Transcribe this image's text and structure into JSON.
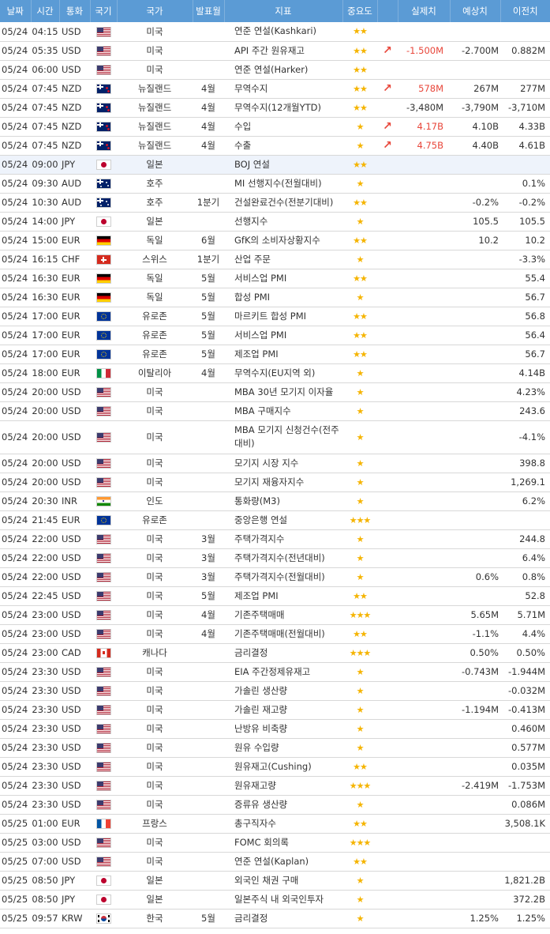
{
  "headers": {
    "date": "날짜",
    "time": "시간",
    "currency": "통화",
    "flag": "국기",
    "country": "국가",
    "period": "발표월",
    "indicator": "지표",
    "importance": "중요도",
    "arrow": "",
    "actual": "실제치",
    "forecast": "예상치",
    "previous": "이전치"
  },
  "colors": {
    "header_bg": "#5b9bd5",
    "header_text": "#ffffff",
    "star": "#f5b400",
    "actual_beat": "#e8463a",
    "row_highlight": "#eef3fb"
  },
  "rows": [
    {
      "date": "05/24",
      "time": "04:15",
      "currency": "USD",
      "flag": "us-flag",
      "country": "미국",
      "period": "",
      "indicator": "연준 연설(Kashkari)",
      "stars": "★★",
      "arrow": "",
      "actual": "",
      "forecast": "",
      "previous": ""
    },
    {
      "date": "05/24",
      "time": "05:35",
      "currency": "USD",
      "flag": "us-flag",
      "country": "미국",
      "period": "",
      "indicator": "API 주간 원유재고",
      "stars": "★★",
      "arrow": "↗",
      "actual": "-1.500M",
      "forecast": "-2.700M",
      "previous": "0.882M"
    },
    {
      "date": "05/24",
      "time": "06:00",
      "currency": "USD",
      "flag": "us-flag",
      "country": "미국",
      "period": "",
      "indicator": "연준 연설(Harker)",
      "stars": "★★",
      "arrow": "",
      "actual": "",
      "forecast": "",
      "previous": ""
    },
    {
      "date": "05/24",
      "time": "07:45",
      "currency": "NZD",
      "flag": "nz-flag",
      "country": "뉴질랜드",
      "period": "4월",
      "indicator": "무역수지",
      "stars": "★★",
      "arrow": "↗",
      "actual": "578M",
      "forecast": "267M",
      "previous": "277M"
    },
    {
      "date": "05/24",
      "time": "07:45",
      "currency": "NZD",
      "flag": "nz-flag",
      "country": "뉴질랜드",
      "period": "4월",
      "indicator": "무역수지(12개월YTD)",
      "stars": "★★",
      "arrow": "",
      "actual": "-3,480M",
      "forecast": "-3,790M",
      "previous": "-3,710M"
    },
    {
      "date": "05/24",
      "time": "07:45",
      "currency": "NZD",
      "flag": "nz-flag",
      "country": "뉴질랜드",
      "period": "4월",
      "indicator": "수입",
      "stars": "★",
      "arrow": "↗",
      "actual": "4.17B",
      "forecast": "4.10B",
      "previous": "4.33B"
    },
    {
      "date": "05/24",
      "time": "07:45",
      "currency": "NZD",
      "flag": "nz-flag",
      "country": "뉴질랜드",
      "period": "4월",
      "indicator": "수출",
      "stars": "★",
      "arrow": "↗",
      "actual": "4.75B",
      "forecast": "4.40B",
      "previous": "4.61B"
    },
    {
      "date": "05/24",
      "time": "09:00",
      "currency": "JPY",
      "flag": "jp-flag",
      "country": "일본",
      "period": "",
      "indicator": "BOJ 연설",
      "stars": "★★",
      "arrow": "",
      "actual": "",
      "forecast": "",
      "previous": ""
    },
    {
      "date": "05/24",
      "time": "09:30",
      "currency": "AUD",
      "flag": "au-flag",
      "country": "호주",
      "period": "",
      "indicator": "MI 선행지수(전월대비)",
      "stars": "★",
      "arrow": "",
      "actual": "",
      "forecast": "",
      "previous": "0.1%"
    },
    {
      "date": "05/24",
      "time": "10:30",
      "currency": "AUD",
      "flag": "au-flag",
      "country": "호주",
      "period": "1분기",
      "indicator": "건설완료건수(전분기대비)",
      "stars": "★★",
      "arrow": "",
      "actual": "",
      "forecast": "-0.2%",
      "previous": "-0.2%"
    },
    {
      "date": "05/24",
      "time": "14:00",
      "currency": "JPY",
      "flag": "jp-flag",
      "country": "일본",
      "period": "",
      "indicator": "선행지수",
      "stars": "★",
      "arrow": "",
      "actual": "",
      "forecast": "105.5",
      "previous": "105.5"
    },
    {
      "date": "05/24",
      "time": "15:00",
      "currency": "EUR",
      "flag": "de-flag",
      "country": "독일",
      "period": "6월",
      "indicator": "GfK의 소비자상황지수",
      "stars": "★★",
      "arrow": "",
      "actual": "",
      "forecast": "10.2",
      "previous": "10.2"
    },
    {
      "date": "05/24",
      "time": "16:15",
      "currency": "CHF",
      "flag": "ch-flag",
      "country": "스위스",
      "period": "1분기",
      "indicator": "산업 주문",
      "stars": "★",
      "arrow": "",
      "actual": "",
      "forecast": "",
      "previous": "-3.3%"
    },
    {
      "date": "05/24",
      "time": "16:30",
      "currency": "EUR",
      "flag": "de-flag",
      "country": "독일",
      "period": "5월",
      "indicator": "서비스업 PMI",
      "stars": "★★",
      "arrow": "",
      "actual": "",
      "forecast": "",
      "previous": "55.4"
    },
    {
      "date": "05/24",
      "time": "16:30",
      "currency": "EUR",
      "flag": "de-flag",
      "country": "독일",
      "period": "5월",
      "indicator": "합성 PMI",
      "stars": "★",
      "arrow": "",
      "actual": "",
      "forecast": "",
      "previous": "56.7"
    },
    {
      "date": "05/24",
      "time": "17:00",
      "currency": "EUR",
      "flag": "eu-flag",
      "country": "유로존",
      "period": "5월",
      "indicator": "마르키트 합성 PMI",
      "stars": "★★",
      "arrow": "",
      "actual": "",
      "forecast": "",
      "previous": "56.8"
    },
    {
      "date": "05/24",
      "time": "17:00",
      "currency": "EUR",
      "flag": "eu-flag",
      "country": "유로존",
      "period": "5월",
      "indicator": "서비스업 PMI",
      "stars": "★★",
      "arrow": "",
      "actual": "",
      "forecast": "",
      "previous": "56.4"
    },
    {
      "date": "05/24",
      "time": "17:00",
      "currency": "EUR",
      "flag": "eu-flag",
      "country": "유로존",
      "period": "5월",
      "indicator": "제조업 PMI",
      "stars": "★★",
      "arrow": "",
      "actual": "",
      "forecast": "",
      "previous": "56.7"
    },
    {
      "date": "05/24",
      "time": "18:00",
      "currency": "EUR",
      "flag": "it-flag",
      "country": "이탈리아",
      "period": "4월",
      "indicator": "무역수지(EU지역 외)",
      "stars": "★",
      "arrow": "",
      "actual": "",
      "forecast": "",
      "previous": "4.14B"
    },
    {
      "date": "05/24",
      "time": "20:00",
      "currency": "USD",
      "flag": "us-flag",
      "country": "미국",
      "period": "",
      "indicator": "MBA 30년 모기지 이자율",
      "stars": "★",
      "arrow": "",
      "actual": "",
      "forecast": "",
      "previous": "4.23%"
    },
    {
      "date": "05/24",
      "time": "20:00",
      "currency": "USD",
      "flag": "us-flag",
      "country": "미국",
      "period": "",
      "indicator": "MBA 구매지수",
      "stars": "★",
      "arrow": "",
      "actual": "",
      "forecast": "",
      "previous": "243.6"
    },
    {
      "date": "05/24",
      "time": "20:00",
      "currency": "USD",
      "flag": "us-flag",
      "country": "미국",
      "period": "",
      "indicator": "MBA 모기지 신청건수(전주대비)",
      "stars": "★",
      "arrow": "",
      "actual": "",
      "forecast": "",
      "previous": "-4.1%",
      "tall": true
    },
    {
      "date": "05/24",
      "time": "20:00",
      "currency": "USD",
      "flag": "us-flag",
      "country": "미국",
      "period": "",
      "indicator": "모기지 시장 지수",
      "stars": "★",
      "arrow": "",
      "actual": "",
      "forecast": "",
      "previous": "398.8"
    },
    {
      "date": "05/24",
      "time": "20:00",
      "currency": "USD",
      "flag": "us-flag",
      "country": "미국",
      "period": "",
      "indicator": "모기지 재융자지수",
      "stars": "★",
      "arrow": "",
      "actual": "",
      "forecast": "",
      "previous": "1,269.1"
    },
    {
      "date": "05/24",
      "time": "20:30",
      "currency": "INR",
      "flag": "in-flag",
      "country": "인도",
      "period": "",
      "indicator": "통화량(M3)",
      "stars": "★",
      "arrow": "",
      "actual": "",
      "forecast": "",
      "previous": "6.2%"
    },
    {
      "date": "05/24",
      "time": "21:45",
      "currency": "EUR",
      "flag": "eu-flag",
      "country": "유로존",
      "period": "",
      "indicator": "중앙은행 연설",
      "stars": "★★★",
      "arrow": "",
      "actual": "",
      "forecast": "",
      "previous": ""
    },
    {
      "date": "05/24",
      "time": "22:00",
      "currency": "USD",
      "flag": "us-flag",
      "country": "미국",
      "period": "3월",
      "indicator": "주택가격지수",
      "stars": "★",
      "arrow": "",
      "actual": "",
      "forecast": "",
      "previous": "244.8"
    },
    {
      "date": "05/24",
      "time": "22:00",
      "currency": "USD",
      "flag": "us-flag",
      "country": "미국",
      "period": "3월",
      "indicator": "주택가격지수(전년대비)",
      "stars": "★",
      "arrow": "",
      "actual": "",
      "forecast": "",
      "previous": "6.4%"
    },
    {
      "date": "05/24",
      "time": "22:00",
      "currency": "USD",
      "flag": "us-flag",
      "country": "미국",
      "period": "3월",
      "indicator": "주택가격지수(전월대비)",
      "stars": "★",
      "arrow": "",
      "actual": "",
      "forecast": "0.6%",
      "previous": "0.8%"
    },
    {
      "date": "05/24",
      "time": "22:45",
      "currency": "USD",
      "flag": "us-flag",
      "country": "미국",
      "period": "5월",
      "indicator": "제조업 PMI",
      "stars": "★★",
      "arrow": "",
      "actual": "",
      "forecast": "",
      "previous": "52.8"
    },
    {
      "date": "05/24",
      "time": "23:00",
      "currency": "USD",
      "flag": "us-flag",
      "country": "미국",
      "period": "4월",
      "indicator": "기존주택매매",
      "stars": "★★★",
      "arrow": "",
      "actual": "",
      "forecast": "5.65M",
      "previous": "5.71M"
    },
    {
      "date": "05/24",
      "time": "23:00",
      "currency": "USD",
      "flag": "us-flag",
      "country": "미국",
      "period": "4월",
      "indicator": "기존주택매매(전월대비)",
      "stars": "★★",
      "arrow": "",
      "actual": "",
      "forecast": "-1.1%",
      "previous": "4.4%"
    },
    {
      "date": "05/24",
      "time": "23:00",
      "currency": "CAD",
      "flag": "ca-flag",
      "country": "캐나다",
      "period": "",
      "indicator": "금리결정",
      "stars": "★★★",
      "arrow": "",
      "actual": "",
      "forecast": "0.50%",
      "previous": "0.50%"
    },
    {
      "date": "05/24",
      "time": "23:30",
      "currency": "USD",
      "flag": "us-flag",
      "country": "미국",
      "period": "",
      "indicator": "EIA 주간정제유재고",
      "stars": "★",
      "arrow": "",
      "actual": "",
      "forecast": "-0.743M",
      "previous": "-1.944M"
    },
    {
      "date": "05/24",
      "time": "23:30",
      "currency": "USD",
      "flag": "us-flag",
      "country": "미국",
      "period": "",
      "indicator": "가솔린 생산량",
      "stars": "★",
      "arrow": "",
      "actual": "",
      "forecast": "",
      "previous": "-0.032M"
    },
    {
      "date": "05/24",
      "time": "23:30",
      "currency": "USD",
      "flag": "us-flag",
      "country": "미국",
      "period": "",
      "indicator": "가솔린 재고량",
      "stars": "★",
      "arrow": "",
      "actual": "",
      "forecast": "-1.194M",
      "previous": "-0.413M"
    },
    {
      "date": "05/24",
      "time": "23:30",
      "currency": "USD",
      "flag": "us-flag",
      "country": "미국",
      "period": "",
      "indicator": "난방유 비축량",
      "stars": "★",
      "arrow": "",
      "actual": "",
      "forecast": "",
      "previous": "0.460M"
    },
    {
      "date": "05/24",
      "time": "23:30",
      "currency": "USD",
      "flag": "us-flag",
      "country": "미국",
      "period": "",
      "indicator": "원유 수입량",
      "stars": "★",
      "arrow": "",
      "actual": "",
      "forecast": "",
      "previous": "0.577M"
    },
    {
      "date": "05/24",
      "time": "23:30",
      "currency": "USD",
      "flag": "us-flag",
      "country": "미국",
      "period": "",
      "indicator": "원유재고(Cushing)",
      "stars": "★★",
      "arrow": "",
      "actual": "",
      "forecast": "",
      "previous": "0.035M"
    },
    {
      "date": "05/24",
      "time": "23:30",
      "currency": "USD",
      "flag": "us-flag",
      "country": "미국",
      "period": "",
      "indicator": "원유재고량",
      "stars": "★★★",
      "arrow": "",
      "actual": "",
      "forecast": "-2.419M",
      "previous": "-1.753M"
    },
    {
      "date": "05/24",
      "time": "23:30",
      "currency": "USD",
      "flag": "us-flag",
      "country": "미국",
      "period": "",
      "indicator": "증류유 생산량",
      "stars": "★",
      "arrow": "",
      "actual": "",
      "forecast": "",
      "previous": "0.086M"
    },
    {
      "date": "05/25",
      "time": "01:00",
      "currency": "EUR",
      "flag": "fr-flag",
      "country": "프랑스",
      "period": "",
      "indicator": "총구직자수",
      "stars": "★★",
      "arrow": "",
      "actual": "",
      "forecast": "",
      "previous": "3,508.1K"
    },
    {
      "date": "05/25",
      "time": "03:00",
      "currency": "USD",
      "flag": "us-flag",
      "country": "미국",
      "period": "",
      "indicator": "FOMC 회의록",
      "stars": "★★★",
      "arrow": "",
      "actual": "",
      "forecast": "",
      "previous": ""
    },
    {
      "date": "05/25",
      "time": "07:00",
      "currency": "USD",
      "flag": "us-flag",
      "country": "미국",
      "period": "",
      "indicator": "연준 연설(Kaplan)",
      "stars": "★★",
      "arrow": "",
      "actual": "",
      "forecast": "",
      "previous": ""
    },
    {
      "date": "05/25",
      "time": "08:50",
      "currency": "JPY",
      "flag": "jp-flag",
      "country": "일본",
      "period": "",
      "indicator": "외국인 채권 구매",
      "stars": "★",
      "arrow": "",
      "actual": "",
      "forecast": "",
      "previous": "1,821.2B"
    },
    {
      "date": "05/25",
      "time": "08:50",
      "currency": "JPY",
      "flag": "jp-flag",
      "country": "일본",
      "period": "",
      "indicator": "일본주식 내 외국인투자",
      "stars": "★",
      "arrow": "",
      "actual": "",
      "forecast": "",
      "previous": "372.2B"
    },
    {
      "date": "05/25",
      "time": "09:57",
      "currency": "KRW",
      "flag": "kr-flag",
      "country": "한국",
      "period": "5월",
      "indicator": "금리결정",
      "stars": "★",
      "arrow": "",
      "actual": "",
      "forecast": "1.25%",
      "previous": "1.25%"
    }
  ]
}
